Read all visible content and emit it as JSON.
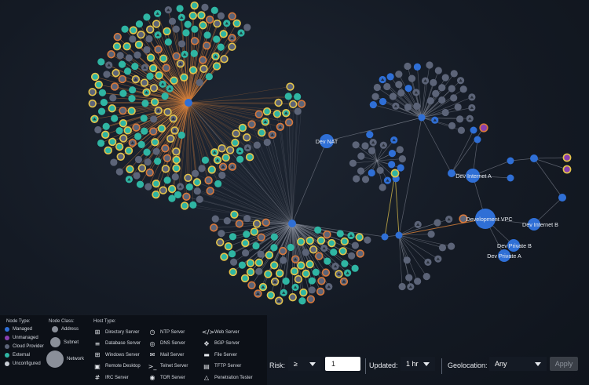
{
  "graph": {
    "node_labels": [
      "Dev NAT",
      "Dev Internet A",
      "Development VPC",
      "Dev Internet B",
      "Dev Private B",
      "Dev Private A"
    ],
    "colors": {
      "managed": "#2f6fd6",
      "unmanaged": "#8a3fb0",
      "cloud_provider": "#5c6478",
      "external": "#2fb5a3",
      "unconfigured": "#c7ccd4",
      "ring_gold": "#e5c44a",
      "ring_orange": "#d9783a",
      "edge_orange": "#d9823a",
      "edge_gray": "#8a909c",
      "edge_gold": "#d8bb4a"
    }
  },
  "legend": {
    "node_type": {
      "title": "Node Type:",
      "items": [
        {
          "label": "Managed",
          "color": "#2f6fd6"
        },
        {
          "label": "Unmanaged",
          "color": "#8a3fb0"
        },
        {
          "label": "Cloud Provider",
          "color": "#5c6478"
        },
        {
          "label": "External",
          "color": "#2fb5a3"
        },
        {
          "label": "Unconfigured",
          "color": "#c7ccd4"
        }
      ]
    },
    "node_class": {
      "title": "Node Class:",
      "items": [
        {
          "label": "Address"
        },
        {
          "label": "Subnet"
        },
        {
          "label": "Network"
        }
      ]
    },
    "host_type": {
      "title": "Host Type:",
      "items": [
        {
          "label": "Directory Server",
          "icon": "directory-server-icon"
        },
        {
          "label": "NTP Server",
          "icon": "ntp-server-icon"
        },
        {
          "label": "Web Server",
          "icon": "web-server-icon"
        },
        {
          "label": "Database Server",
          "icon": "database-server-icon"
        },
        {
          "label": "DNS Server",
          "icon": "dns-server-icon"
        },
        {
          "label": "BGP Server",
          "icon": "bgp-server-icon"
        },
        {
          "label": "Windows Server",
          "icon": "windows-server-icon"
        },
        {
          "label": "Mail Server",
          "icon": "mail-server-icon"
        },
        {
          "label": "File Server",
          "icon": "file-server-icon"
        },
        {
          "label": "Remote Desktop",
          "icon": "remote-desktop-icon"
        },
        {
          "label": "Telnet Server",
          "icon": "telnet-server-icon"
        },
        {
          "label": "TFTP Server",
          "icon": "tftp-server-icon"
        },
        {
          "label": "IRC Server",
          "icon": "irc-server-icon"
        },
        {
          "label": "TOR Server",
          "icon": "tor-server-icon"
        },
        {
          "label": "Penetration Tester",
          "icon": "penetration-tester-icon"
        }
      ]
    }
  },
  "filters": {
    "risk_label": "Risk:",
    "risk_operator": "≥",
    "risk_value": "1",
    "updated_label": "Updated:",
    "updated_value": "1 hr",
    "geolocation_label": "Geolocation:",
    "geolocation_value": "Any",
    "apply_label": "Apply"
  }
}
